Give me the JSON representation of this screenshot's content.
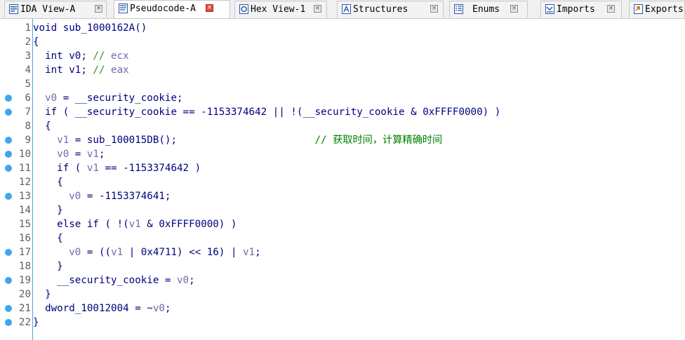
{
  "tabs": [
    {
      "label": "IDA View-A",
      "icon": "ida-view-icon",
      "active": false
    },
    {
      "label": "Pseudocode-A",
      "icon": "pseudocode-icon",
      "active": true
    },
    {
      "label": "Hex View-1",
      "icon": "hex-view-icon",
      "active": false
    },
    {
      "label": "Structures",
      "icon": "structures-icon",
      "active": false
    },
    {
      "label": "Enums",
      "icon": "enums-icon",
      "active": false
    },
    {
      "label": "Imports",
      "icon": "imports-icon",
      "active": false
    },
    {
      "label": "Exports",
      "icon": "exports-icon",
      "active": false
    }
  ],
  "code": {
    "lines": [
      {
        "n": "1",
        "bp": false,
        "tokens": [
          [
            "t",
            "void sub_1000162A()"
          ]
        ]
      },
      {
        "n": "2",
        "bp": false,
        "tokens": [
          [
            "t",
            "{"
          ]
        ]
      },
      {
        "n": "3",
        "bp": false,
        "tokens": [
          [
            "t",
            "  int v0; "
          ],
          [
            "c",
            "// "
          ],
          [
            "v",
            "ecx"
          ]
        ]
      },
      {
        "n": "4",
        "bp": false,
        "tokens": [
          [
            "t",
            "  int v1; "
          ],
          [
            "c",
            "// "
          ],
          [
            "v",
            "eax"
          ]
        ]
      },
      {
        "n": "5",
        "bp": false,
        "tokens": []
      },
      {
        "n": "6",
        "bp": true,
        "tokens": [
          [
            "v",
            "  v0"
          ],
          [
            "t",
            " = __security_cookie;"
          ]
        ]
      },
      {
        "n": "7",
        "bp": true,
        "tokens": [
          [
            "t",
            "  if ( __security_cookie == -1153374642 || !(__security_cookie & 0xFFFF0000) )"
          ]
        ]
      },
      {
        "n": "8",
        "bp": false,
        "tokens": [
          [
            "t",
            "  {"
          ]
        ]
      },
      {
        "n": "9",
        "bp": true,
        "tokens": [
          [
            "v",
            "    v1"
          ],
          [
            "t",
            " = sub_100015DB();                       "
          ],
          [
            "cm",
            "// 获取时间，计算精确时间"
          ]
        ]
      },
      {
        "n": "10",
        "bp": true,
        "tokens": [
          [
            "v",
            "    v0"
          ],
          [
            "t",
            " = "
          ],
          [
            "v",
            "v1"
          ],
          [
            "t",
            ";"
          ]
        ]
      },
      {
        "n": "11",
        "bp": true,
        "tokens": [
          [
            "t",
            "    if ( "
          ],
          [
            "v",
            "v1"
          ],
          [
            "t",
            " == -1153374642 )"
          ]
        ]
      },
      {
        "n": "12",
        "bp": false,
        "tokens": [
          [
            "t",
            "    {"
          ]
        ]
      },
      {
        "n": "13",
        "bp": true,
        "tokens": [
          [
            "v",
            "      v0"
          ],
          [
            "t",
            " = -1153374641;"
          ]
        ]
      },
      {
        "n": "14",
        "bp": false,
        "tokens": [
          [
            "t",
            "    }"
          ]
        ]
      },
      {
        "n": "15",
        "bp": false,
        "tokens": [
          [
            "t",
            "    else if ( !("
          ],
          [
            "v",
            "v1"
          ],
          [
            "t",
            " & 0xFFFF0000) )"
          ]
        ]
      },
      {
        "n": "16",
        "bp": false,
        "tokens": [
          [
            "t",
            "    {"
          ]
        ]
      },
      {
        "n": "17",
        "bp": true,
        "tokens": [
          [
            "v",
            "      v0"
          ],
          [
            "t",
            " = (("
          ],
          [
            "v",
            "v1"
          ],
          [
            "t",
            " | 0x4711) << 16) | "
          ],
          [
            "v",
            "v1"
          ],
          [
            "t",
            ";"
          ]
        ]
      },
      {
        "n": "18",
        "bp": false,
        "tokens": [
          [
            "t",
            "    }"
          ]
        ]
      },
      {
        "n": "19",
        "bp": true,
        "tokens": [
          [
            "t",
            "    __security_cookie = "
          ],
          [
            "v",
            "v0"
          ],
          [
            "t",
            ";"
          ]
        ]
      },
      {
        "n": "20",
        "bp": false,
        "tokens": [
          [
            "t",
            "  }"
          ]
        ]
      },
      {
        "n": "21",
        "bp": true,
        "tokens": [
          [
            "t",
            "  dword_10012004 = ~"
          ],
          [
            "v",
            "v0"
          ],
          [
            "t",
            ";"
          ]
        ]
      },
      {
        "n": "22",
        "bp": true,
        "tokens": [
          [
            "t",
            "}"
          ]
        ]
      }
    ]
  },
  "colors": {
    "keyword_text": "#000080",
    "variable": "#6b6bb0",
    "comment": "#008000",
    "breakpoint": "#3ca8ec",
    "close_active": "#e14c3c"
  }
}
